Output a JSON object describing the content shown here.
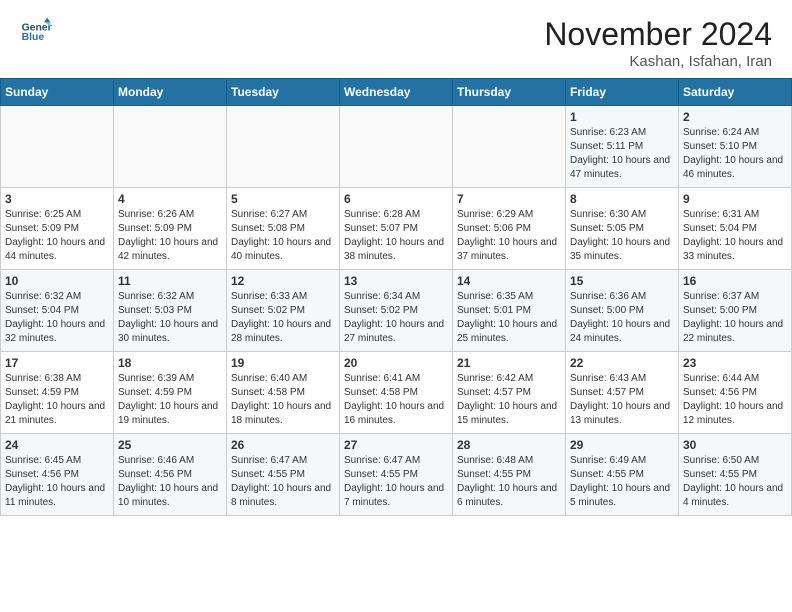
{
  "header": {
    "logo_line1": "General",
    "logo_line2": "Blue",
    "month": "November 2024",
    "location": "Kashan, Isfahan, Iran"
  },
  "weekdays": [
    "Sunday",
    "Monday",
    "Tuesday",
    "Wednesday",
    "Thursday",
    "Friday",
    "Saturday"
  ],
  "rows": [
    [
      {
        "day": "",
        "info": ""
      },
      {
        "day": "",
        "info": ""
      },
      {
        "day": "",
        "info": ""
      },
      {
        "day": "",
        "info": ""
      },
      {
        "day": "",
        "info": ""
      },
      {
        "day": "1",
        "info": "Sunrise: 6:23 AM\nSunset: 5:11 PM\nDaylight: 10 hours and 47 minutes."
      },
      {
        "day": "2",
        "info": "Sunrise: 6:24 AM\nSunset: 5:10 PM\nDaylight: 10 hours and 46 minutes."
      }
    ],
    [
      {
        "day": "3",
        "info": "Sunrise: 6:25 AM\nSunset: 5:09 PM\nDaylight: 10 hours and 44 minutes."
      },
      {
        "day": "4",
        "info": "Sunrise: 6:26 AM\nSunset: 5:09 PM\nDaylight: 10 hours and 42 minutes."
      },
      {
        "day": "5",
        "info": "Sunrise: 6:27 AM\nSunset: 5:08 PM\nDaylight: 10 hours and 40 minutes."
      },
      {
        "day": "6",
        "info": "Sunrise: 6:28 AM\nSunset: 5:07 PM\nDaylight: 10 hours and 38 minutes."
      },
      {
        "day": "7",
        "info": "Sunrise: 6:29 AM\nSunset: 5:06 PM\nDaylight: 10 hours and 37 minutes."
      },
      {
        "day": "8",
        "info": "Sunrise: 6:30 AM\nSunset: 5:05 PM\nDaylight: 10 hours and 35 minutes."
      },
      {
        "day": "9",
        "info": "Sunrise: 6:31 AM\nSunset: 5:04 PM\nDaylight: 10 hours and 33 minutes."
      }
    ],
    [
      {
        "day": "10",
        "info": "Sunrise: 6:32 AM\nSunset: 5:04 PM\nDaylight: 10 hours and 32 minutes."
      },
      {
        "day": "11",
        "info": "Sunrise: 6:32 AM\nSunset: 5:03 PM\nDaylight: 10 hours and 30 minutes."
      },
      {
        "day": "12",
        "info": "Sunrise: 6:33 AM\nSunset: 5:02 PM\nDaylight: 10 hours and 28 minutes."
      },
      {
        "day": "13",
        "info": "Sunrise: 6:34 AM\nSunset: 5:02 PM\nDaylight: 10 hours and 27 minutes."
      },
      {
        "day": "14",
        "info": "Sunrise: 6:35 AM\nSunset: 5:01 PM\nDaylight: 10 hours and 25 minutes."
      },
      {
        "day": "15",
        "info": "Sunrise: 6:36 AM\nSunset: 5:00 PM\nDaylight: 10 hours and 24 minutes."
      },
      {
        "day": "16",
        "info": "Sunrise: 6:37 AM\nSunset: 5:00 PM\nDaylight: 10 hours and 22 minutes."
      }
    ],
    [
      {
        "day": "17",
        "info": "Sunrise: 6:38 AM\nSunset: 4:59 PM\nDaylight: 10 hours and 21 minutes."
      },
      {
        "day": "18",
        "info": "Sunrise: 6:39 AM\nSunset: 4:59 PM\nDaylight: 10 hours and 19 minutes."
      },
      {
        "day": "19",
        "info": "Sunrise: 6:40 AM\nSunset: 4:58 PM\nDaylight: 10 hours and 18 minutes."
      },
      {
        "day": "20",
        "info": "Sunrise: 6:41 AM\nSunset: 4:58 PM\nDaylight: 10 hours and 16 minutes."
      },
      {
        "day": "21",
        "info": "Sunrise: 6:42 AM\nSunset: 4:57 PM\nDaylight: 10 hours and 15 minutes."
      },
      {
        "day": "22",
        "info": "Sunrise: 6:43 AM\nSunset: 4:57 PM\nDaylight: 10 hours and 13 minutes."
      },
      {
        "day": "23",
        "info": "Sunrise: 6:44 AM\nSunset: 4:56 PM\nDaylight: 10 hours and 12 minutes."
      }
    ],
    [
      {
        "day": "24",
        "info": "Sunrise: 6:45 AM\nSunset: 4:56 PM\nDaylight: 10 hours and 11 minutes."
      },
      {
        "day": "25",
        "info": "Sunrise: 6:46 AM\nSunset: 4:56 PM\nDaylight: 10 hours and 10 minutes."
      },
      {
        "day": "26",
        "info": "Sunrise: 6:47 AM\nSunset: 4:55 PM\nDaylight: 10 hours and 8 minutes."
      },
      {
        "day": "27",
        "info": "Sunrise: 6:47 AM\nSunset: 4:55 PM\nDaylight: 10 hours and 7 minutes."
      },
      {
        "day": "28",
        "info": "Sunrise: 6:48 AM\nSunset: 4:55 PM\nDaylight: 10 hours and 6 minutes."
      },
      {
        "day": "29",
        "info": "Sunrise: 6:49 AM\nSunset: 4:55 PM\nDaylight: 10 hours and 5 minutes."
      },
      {
        "day": "30",
        "info": "Sunrise: 6:50 AM\nSunset: 4:55 PM\nDaylight: 10 hours and 4 minutes."
      }
    ]
  ]
}
